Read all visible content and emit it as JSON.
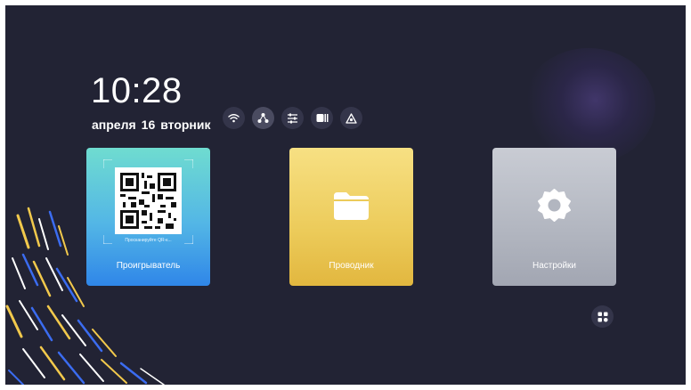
{
  "clock": {
    "time": "10:28",
    "month": "апреля",
    "day": "16",
    "weekday": "вторник"
  },
  "status_icons": [
    {
      "name": "wifi-icon"
    },
    {
      "name": "network-icon",
      "active": true
    },
    {
      "name": "sliders-icon"
    },
    {
      "name": "storage-icon"
    },
    {
      "name": "drive-icon"
    }
  ],
  "tiles": {
    "player": {
      "label": "Проигрыватель",
      "qr_caption": "Просканируйте QR-к...",
      "icon": "qr-code-icon"
    },
    "explorer": {
      "label": "Проводник",
      "icon": "folder-icon"
    },
    "settings": {
      "label": "Настройки",
      "icon": "gear-icon"
    }
  },
  "apps_button": {
    "icon": "all-apps-icon"
  },
  "colors": {
    "background": "#222334",
    "player_tile": "#53b6e6",
    "explorer_tile": "#eccb5a",
    "settings_tile": "#b2b6c0"
  }
}
